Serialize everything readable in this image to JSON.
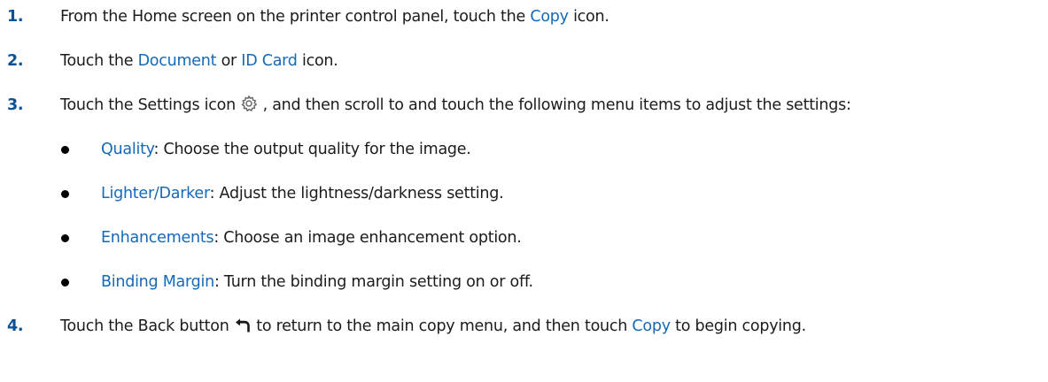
{
  "steps": [
    {
      "number": "1.",
      "before": "From the Home screen on the printer control panel, touch the ",
      "link": "Copy",
      "after": " icon."
    },
    {
      "number": "2.",
      "before": "Touch the ",
      "link1": "Document",
      "middle": " or ",
      "link2": "ID Card",
      "after": " icon."
    },
    {
      "number": "3.",
      "before": "Touch the Settings icon ",
      "icon": "gear-icon",
      "after": " , and then scroll to and touch the following menu items to adjust the settings:"
    },
    {
      "number": "4.",
      "before": "Touch the Back button ",
      "icon": "back-arrow-icon",
      "middle": " to return to the main copy menu, and then touch ",
      "link": "Copy",
      "after": " to begin copying."
    }
  ],
  "settings": [
    {
      "label": "Quality",
      "description": ": Choose the output quality for the image."
    },
    {
      "label": "Lighter/Darker",
      "description": ": Adjust the lightness/darkness setting."
    },
    {
      "label": "Enhancements",
      "description": ": Choose an image enhancement option."
    },
    {
      "label": "Binding Margin",
      "description": ": Turn the binding margin setting on or off."
    }
  ],
  "colors": {
    "number": "#0a5294",
    "link": "#1469b9",
    "text": "#1b1b1b"
  }
}
